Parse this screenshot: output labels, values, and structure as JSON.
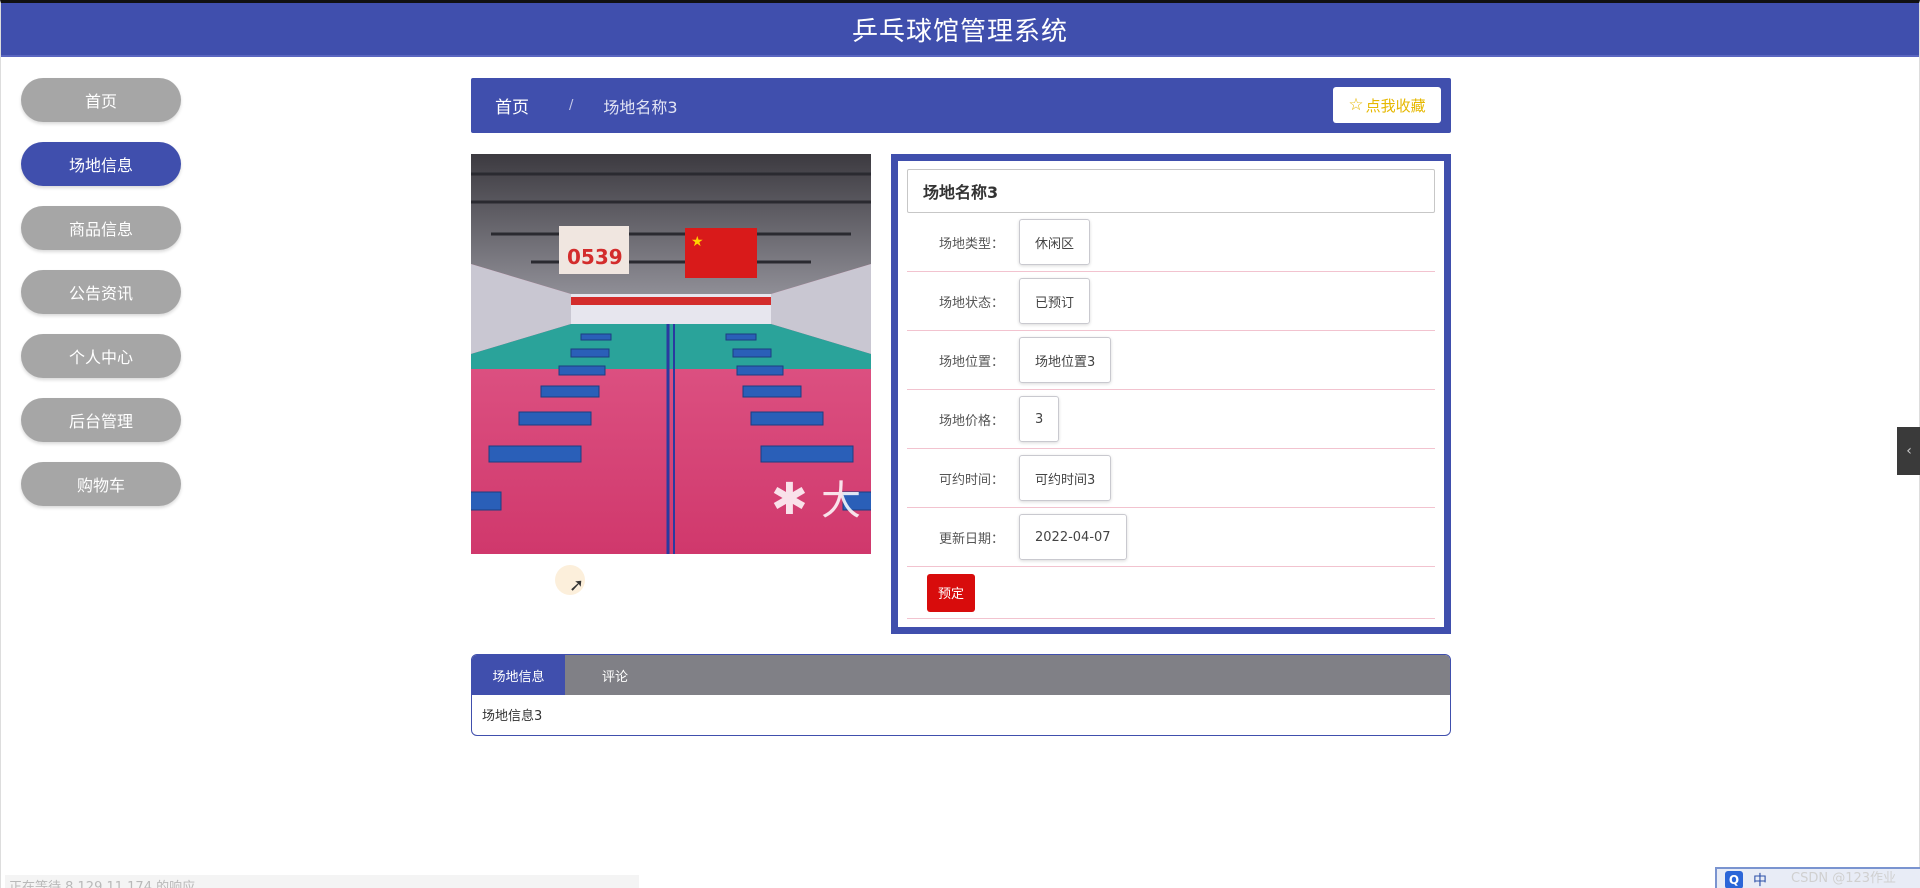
{
  "header": {
    "title": "乒乓球馆管理系统"
  },
  "sidebar": {
    "items": [
      {
        "label": "首页",
        "active": false
      },
      {
        "label": "场地信息",
        "active": true
      },
      {
        "label": "商品信息",
        "active": false
      },
      {
        "label": "公告资讯",
        "active": false
      },
      {
        "label": "个人中心",
        "active": false
      },
      {
        "label": "后台管理",
        "active": false
      },
      {
        "label": "购物车",
        "active": false
      }
    ]
  },
  "breadcrumb": {
    "home": "首页",
    "separator": "/",
    "current": "场地名称3",
    "favorite_label": "点我收藏",
    "favorite_icon": "star-outline-icon"
  },
  "photo": {
    "watermark_text": "大"
  },
  "detail": {
    "title": "场地名称3",
    "fields": [
      {
        "label": "场地类型：",
        "value": "休闲区"
      },
      {
        "label": "场地状态：",
        "value": "已预订"
      },
      {
        "label": "场地位置：",
        "value": "场地位置3"
      },
      {
        "label": "场地价格：",
        "value": "3"
      },
      {
        "label": "可约时间：",
        "value": "可约时间3"
      },
      {
        "label": "更新日期：",
        "value": "2022-04-07"
      }
    ],
    "book_label": "预定"
  },
  "tabs": {
    "items": [
      {
        "label": "场地信息",
        "active": true
      },
      {
        "label": "评论",
        "active": false
      }
    ],
    "content": "场地信息3"
  },
  "status_bar": {
    "text": "正在等待 8.129.11.174 的响应..."
  },
  "ime": {
    "q": "Q",
    "lang": "中"
  },
  "watermark": "CSDN @123作业",
  "colors": {
    "primary": "#404fad",
    "nav_inactive": "#a6a6a6",
    "book_button": "#d80c0c",
    "favorite_text": "#e6b800",
    "tab_bar": "#808086"
  }
}
